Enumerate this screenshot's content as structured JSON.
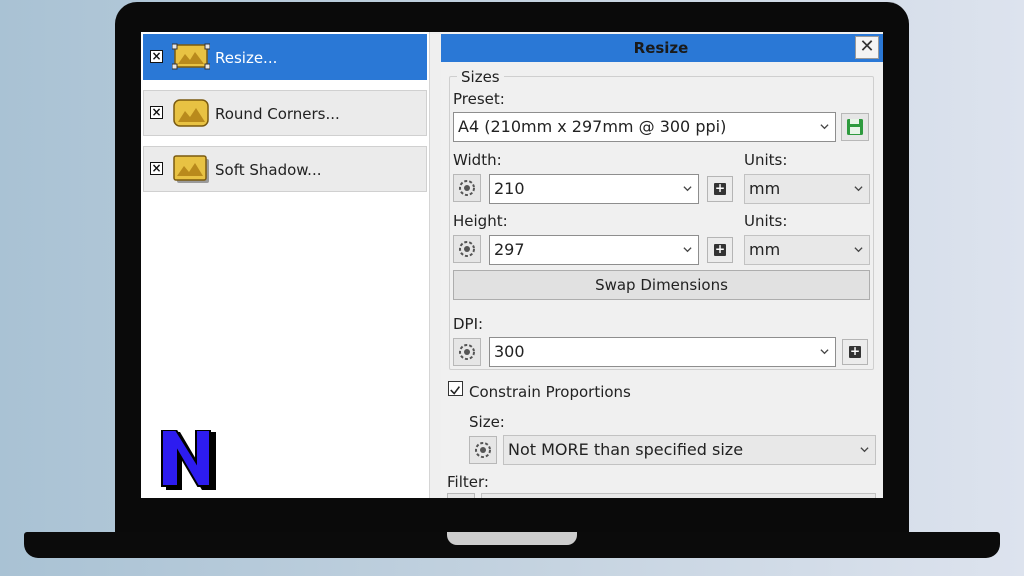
{
  "left_panel": {
    "items": [
      {
        "label": "Resize...",
        "active": true
      },
      {
        "label": "Round Corners...",
        "active": false
      },
      {
        "label": "Soft Shadow...",
        "active": false
      }
    ],
    "logo_letter": "N"
  },
  "dialog": {
    "title": "Resize",
    "close_symbol": "✕",
    "sizes_group": "Sizes",
    "preset_label": "Preset:",
    "preset_value": "A4 (210mm x 297mm @ 300 ppi)",
    "width_label": "Width:",
    "width_value": "210",
    "width_units_label": "Units:",
    "width_units_value": "mm",
    "height_label": "Height:",
    "height_value": "297",
    "height_units_label": "Units:",
    "height_units_value": "mm",
    "swap_button": "Swap Dimensions",
    "dpi_label": "DPI:",
    "dpi_value": "300",
    "constrain_label": "Constrain Proportions",
    "constrain_checked": true,
    "size_label": "Size:",
    "size_value": "Not MORE than specified size",
    "filter_label": "Filter:"
  },
  "colors": {
    "accent": "#2a78d6",
    "save_icon": "#2e9a3e"
  },
  "icons": {
    "save": "floppy-disk-icon",
    "reset": "dial-icon",
    "add": "plus-icon",
    "close": "close-icon",
    "dropdown": "chevron-down-icon"
  }
}
